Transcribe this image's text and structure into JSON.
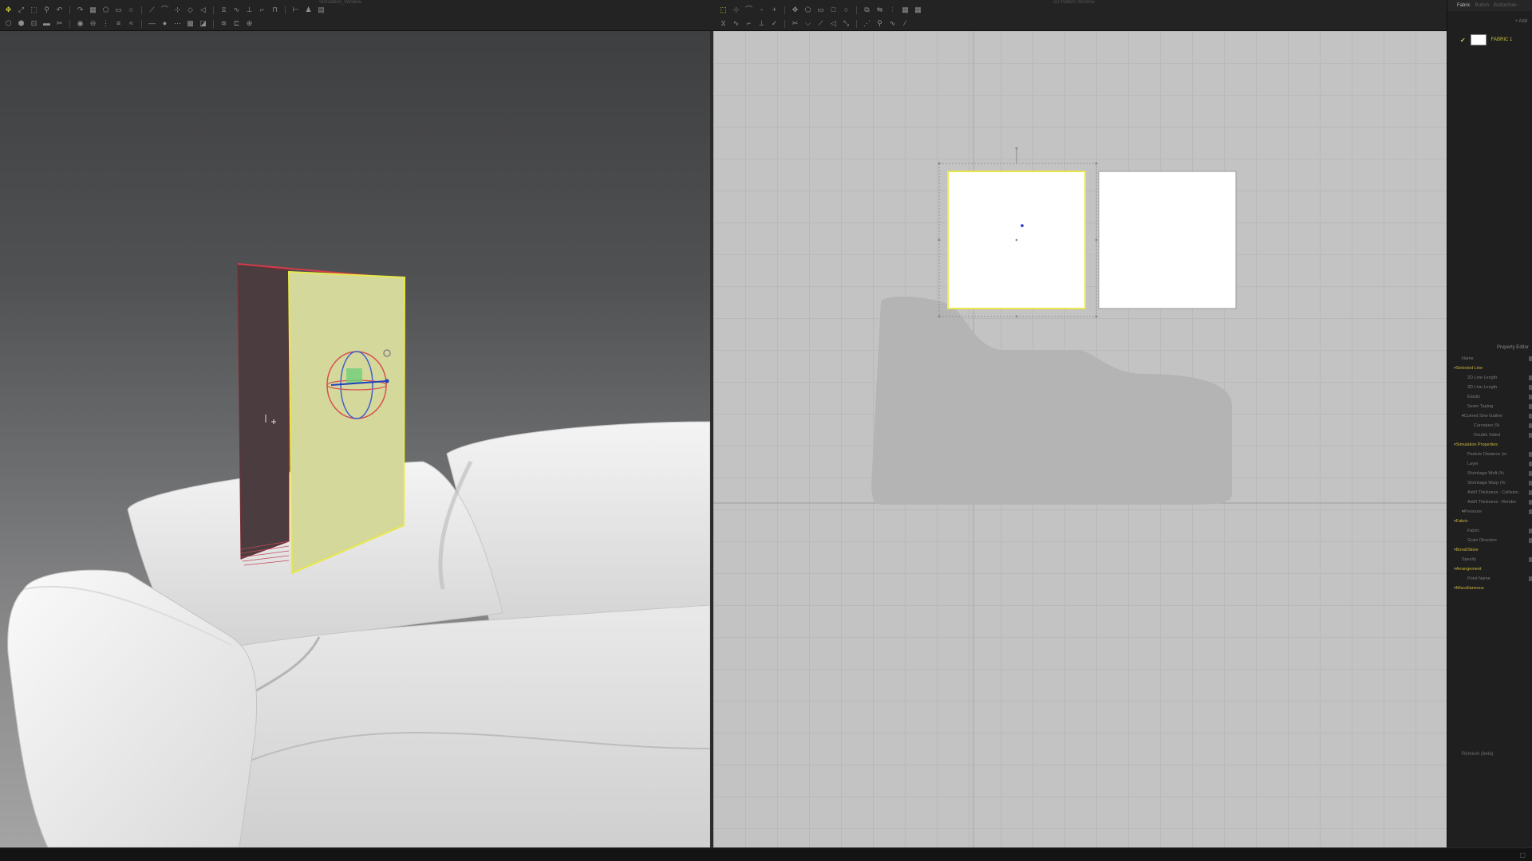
{
  "window": {
    "left_title": "Simulation_Window",
    "right_title": "2D Pattern Window"
  },
  "toolbar_3d": {
    "row1_icons": [
      "select-move-icon",
      "transform-icon",
      "edit-pattern-icon",
      "pin-icon",
      "undo-icon",
      "redo-icon",
      "grid-icon",
      "polygon-icon",
      "rectangle-icon",
      "circle-icon",
      "segment-icon",
      "curve-icon",
      "curve-point-icon",
      "internal-polygon-icon",
      "dart-icon",
      "sewing-icon",
      "free-sewing-icon",
      "tack-icon",
      "fold-icon",
      "fold-arrange-icon",
      "measure-icon",
      "avatar-icon",
      "layout-icon"
    ],
    "row2_icons": [
      "select-mesh-icon",
      "edit-mesh-icon",
      "pin-box-icon",
      "tape-icon",
      "trim-icon",
      "button-icon",
      "buttonhole-icon",
      "zipper-icon",
      "piping-icon",
      "elastic-icon",
      "line-icon",
      "dot-icon",
      "stitch-icon",
      "texture-icon",
      "graphic-icon",
      "puckering-icon",
      "ruler-icon",
      "camera-icon"
    ]
  },
  "toolbar_2d": {
    "row1_icons": [
      "transform-pattern-icon",
      "edit-point-icon",
      "edit-curvature-icon",
      "edit-curve-point-icon",
      "add-point-icon",
      "move-icon",
      "polygon-icon",
      "rectangle-icon",
      "square-icon",
      "circle-icon",
      "copy-icon",
      "mirror-icon",
      "align-icon",
      "grid-icon",
      "table-icon"
    ],
    "row2_icons": [
      "segment-sewing-icon",
      "free-sewing-icon",
      "fold-icon",
      "tack-icon",
      "sewing-check-icon",
      "trim-icon",
      "notch-icon",
      "internal-line-icon",
      "dart-icon",
      "offset-icon",
      "style-line-icon",
      "pin-icon",
      "wave-icon",
      "slash-icon"
    ]
  },
  "right_panel": {
    "tabs": [
      "Fabric",
      "Button",
      "Buttonhole"
    ],
    "active_tab": "Fabric",
    "add_label": "+ Add",
    "fabric_item": {
      "name": "FABRIC 1",
      "color": "#ffffff"
    },
    "property_editor_title": "Property Editor",
    "rows": [
      {
        "label": "Name",
        "kind": "row"
      },
      {
        "label": "Selected Line",
        "kind": "sec"
      },
      {
        "label": "2D Line Length",
        "kind": "sub"
      },
      {
        "label": "3D Line Length",
        "kind": "sub"
      },
      {
        "label": "Elastic",
        "kind": "sub"
      },
      {
        "label": "Seam Taping",
        "kind": "sub"
      },
      {
        "label": "Curved Sew Gather",
        "kind": "sub2"
      },
      {
        "label": "Curvature (%",
        "kind": "sub3"
      },
      {
        "label": "Double Sided",
        "kind": "sub3"
      },
      {
        "label": "Simulation Properties",
        "kind": "sec"
      },
      {
        "label": "Particle Distance (m",
        "kind": "sub"
      },
      {
        "label": "Layer",
        "kind": "sub"
      },
      {
        "label": "Shrinkage Weft (%",
        "kind": "sub"
      },
      {
        "label": "Shrinkage Warp (%",
        "kind": "sub"
      },
      {
        "label": "Add'l Thickness - Collision",
        "kind": "sub"
      },
      {
        "label": "Add'l Thickness - Render",
        "kind": "sub"
      },
      {
        "label": "Pressure",
        "kind": "sub2"
      },
      {
        "label": "Fabric",
        "kind": "sec"
      },
      {
        "label": "Fabric",
        "kind": "sub"
      },
      {
        "label": "Grain Direction",
        "kind": "sub"
      },
      {
        "label": "Bond/Skive",
        "kind": "sec"
      },
      {
        "label": "Specify",
        "kind": "row"
      },
      {
        "label": "Arrangement",
        "kind": "sec"
      },
      {
        "label": "Point Name",
        "kind": "sub"
      },
      {
        "label": "Miscellaneous",
        "kind": "sec"
      }
    ],
    "bottom_label": "Remesh (beta)"
  },
  "colors": {
    "selection_yellow": "#e8e84a",
    "pattern_fill_3d": "#d5d89a",
    "accent": "#c8b43a"
  }
}
